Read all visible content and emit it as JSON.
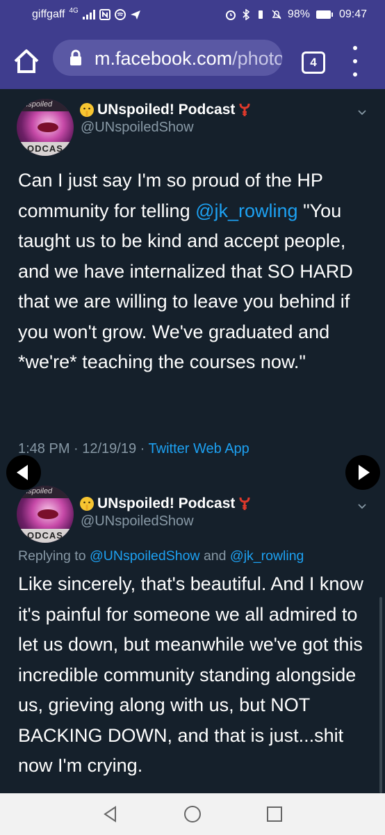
{
  "status_bar": {
    "carrier": "giffgaff",
    "network": "4G",
    "battery": "98%",
    "time": "09:47"
  },
  "browser": {
    "url_main": "m.facebook.com",
    "url_path": "/photo",
    "tab_count": "4"
  },
  "tweets": [
    {
      "author_name": "UNspoiled! Podcast",
      "author_handle": "@UNspoiledShow",
      "avatar_caption": "unspoiled",
      "avatar_footer": "ODCAS",
      "text_1": "Can I just say I'm so proud of the HP community for telling ",
      "mention": "@jk_rowling",
      "text_2": " \"You taught us to be kind and accept people, and we have internalized that SO HARD that we are willing to leave you behind if you won't grow. We've graduated and *we're* teaching the courses now.\"",
      "timestamp": "1:48 PM · 12/19/19 · ",
      "source": "Twitter Web App"
    },
    {
      "author_name": "UNspoiled! Podcast",
      "author_handle": "@UNspoiledShow",
      "avatar_caption": "unspoiled",
      "avatar_footer": "ODCAS",
      "reply_prefix": "Replying to ",
      "reply_to_1": "@UNspoiledShow",
      "reply_and": " and ",
      "reply_to_2": "@jk_rowling",
      "text": "Like sincerely, that's beautiful. And I know it's painful for someone we all admired to let us down, but meanwhile we've got this incredible community standing alongside us, grieving along with us, but NOT BACKING DOWN, and that is just...shit now I'm crying."
    }
  ],
  "icons": {
    "home": "home-icon",
    "lock": "lock-icon",
    "menu": "more-vert-icon",
    "prev": "prev-arrow-icon",
    "next": "next-arrow-icon",
    "back": "back-icon",
    "homenav": "home-circle-icon",
    "recents": "recents-icon"
  },
  "colors": {
    "browser_bar": "#3f3d8e",
    "tweet_bg": "#15202b",
    "link": "#1da1f2",
    "muted": "#8899a6"
  }
}
